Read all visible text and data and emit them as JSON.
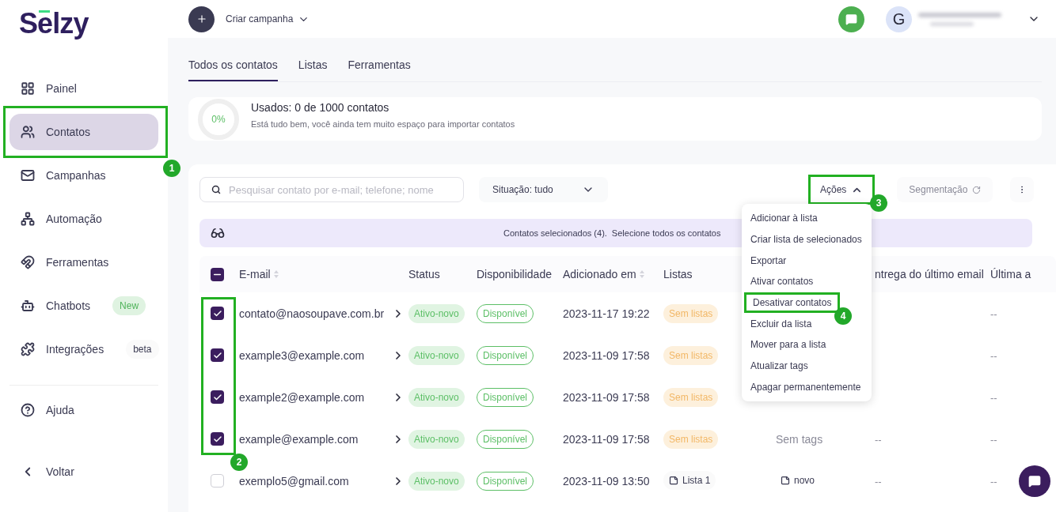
{
  "logo": "Selzy",
  "topbar": {
    "create_label": "Criar campanha",
    "avatar_letter": "G"
  },
  "sidebar": {
    "items": [
      {
        "label": "Painel",
        "selected": false
      },
      {
        "label": "Contatos",
        "selected": true,
        "annotation": "1"
      },
      {
        "label": "Campanhas",
        "selected": false
      },
      {
        "label": "Automação",
        "selected": false
      },
      {
        "label": "Ferramentas",
        "selected": false
      },
      {
        "label": "Chatbots",
        "selected": false,
        "badge": {
          "text": "New",
          "kind": "new"
        }
      },
      {
        "label": "Integrações",
        "selected": false,
        "badge": {
          "text": "beta",
          "kind": "beta"
        }
      }
    ],
    "footer": [
      {
        "label": "Ajuda"
      },
      {
        "label": "Voltar"
      }
    ]
  },
  "tabs": [
    {
      "label": "Todos os contatos",
      "selected": true
    },
    {
      "label": "Listas",
      "selected": false
    },
    {
      "label": "Ferramentas",
      "selected": false
    }
  ],
  "usage": {
    "percent": "0%",
    "level": 0,
    "title": "Usados: 0 de 1000 contatos",
    "subtitle": "Está tudo bem, você ainda tem muito espaço para importar contatos"
  },
  "toolbar": {
    "search_placeholder": "Pesquisar contato por e-mail; telefone; nome",
    "filter": "Situação: tudo",
    "actions": {
      "label": "Ações",
      "expanded": true,
      "annotation": "3"
    },
    "segmentation": "Segmentação"
  },
  "selection_bar": {
    "count_text": "Contatos selecionados (4).",
    "select_all_link": "Selecione todos os contatos"
  },
  "table": {
    "select_all_indeterminate": true,
    "checkbox_annotation": "2",
    "columns": [
      {
        "label": "E-mail",
        "sortable": true
      },
      {
        "label": "Status",
        "sortable": false
      },
      {
        "label": "Disponibilidade",
        "sortable": false
      },
      {
        "label": "Adicionado em",
        "sortable": true
      },
      {
        "label": "Listas",
        "sortable": false
      },
      {
        "label": "ntrega do último email",
        "sortable": false
      },
      {
        "label": "Última a",
        "sortable": false
      }
    ],
    "rows": [
      {
        "email": "contato@naosoupave.com.br",
        "checked": true,
        "status": "Ativo-novo",
        "availability": "Disponível",
        "added": "2023-11-17 19:22",
        "lists": {
          "text": "Sem listas",
          "kind": "none"
        },
        "last_activity": "--"
      },
      {
        "email": "example3@example.com",
        "checked": true,
        "status": "Ativo-novo",
        "availability": "Disponível",
        "added": "2023-11-09 17:58",
        "lists": {
          "text": "Sem listas",
          "kind": "none"
        },
        "last_activity": "--"
      },
      {
        "email": "example2@example.com",
        "checked": true,
        "status": "Ativo-novo",
        "availability": "Disponível",
        "added": "2023-11-09 17:58",
        "lists": {
          "text": "Sem listas",
          "kind": "none"
        },
        "last_activity": "--"
      },
      {
        "email": "example@example.com",
        "checked": true,
        "status": "Ativo-novo",
        "availability": "Disponível",
        "added": "2023-11-09 17:58",
        "lists": {
          "text": "Sem listas",
          "kind": "none"
        },
        "tags": {
          "text": "Sem tags",
          "kind": "none"
        },
        "last_email": "--",
        "last_activity": "--"
      },
      {
        "email": "exemplo5@gmail.com",
        "checked": false,
        "status": "Ativo-novo",
        "availability": "Disponível",
        "added": "2023-11-09 13:50",
        "lists": {
          "text": "Lista 1",
          "kind": "list"
        },
        "tags": {
          "text": "novo",
          "kind": "tag"
        },
        "last_email": "--",
        "last_activity": "--"
      }
    ]
  },
  "actions_menu": {
    "items": [
      {
        "label": "Adicionar à lista"
      },
      {
        "label": "Criar lista de selecionados"
      },
      {
        "label": "Exportar"
      },
      {
        "label": "Ativar contatos"
      },
      {
        "label": "Desativar contatos",
        "annotation": "4"
      },
      {
        "label": "Excluir da lista"
      },
      {
        "label": "Mover para a lista"
      },
      {
        "label": "Atualizar tags"
      },
      {
        "label": "Apagar permanentemente"
      }
    ]
  }
}
